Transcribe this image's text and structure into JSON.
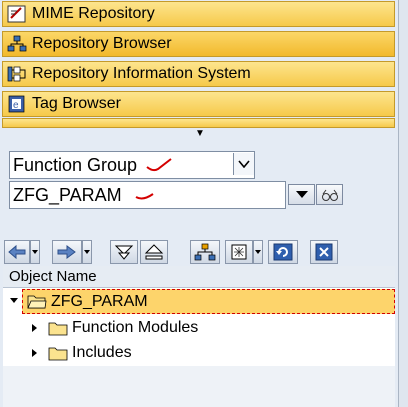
{
  "nav": {
    "items": [
      {
        "label": "MIME Repository",
        "icon": "mime-icon"
      },
      {
        "label": "Repository Browser",
        "icon": "hierarchy-icon",
        "selected": true
      },
      {
        "label": "Repository Information System",
        "icon": "info-system-icon"
      },
      {
        "label": "Tag Browser",
        "icon": "tag-icon"
      }
    ]
  },
  "selector": {
    "object_type": "Function Group",
    "object_name": "ZFG_PARAM"
  },
  "toolbar": {
    "icons": [
      "back-arrow-icon",
      "forward-arrow-icon",
      "collapse-icon",
      "expand-icon",
      "hierarchy-icon",
      "display-icon",
      "refresh-icon",
      "close-icon"
    ]
  },
  "tree": {
    "header": "Object Name",
    "root": "ZFG_PARAM",
    "children": [
      "Function Modules",
      "Includes"
    ]
  },
  "colors": {
    "nav_yellow": "#f6c94a",
    "selected_row": "#fdd46b",
    "annotation_red": "#d40000"
  }
}
